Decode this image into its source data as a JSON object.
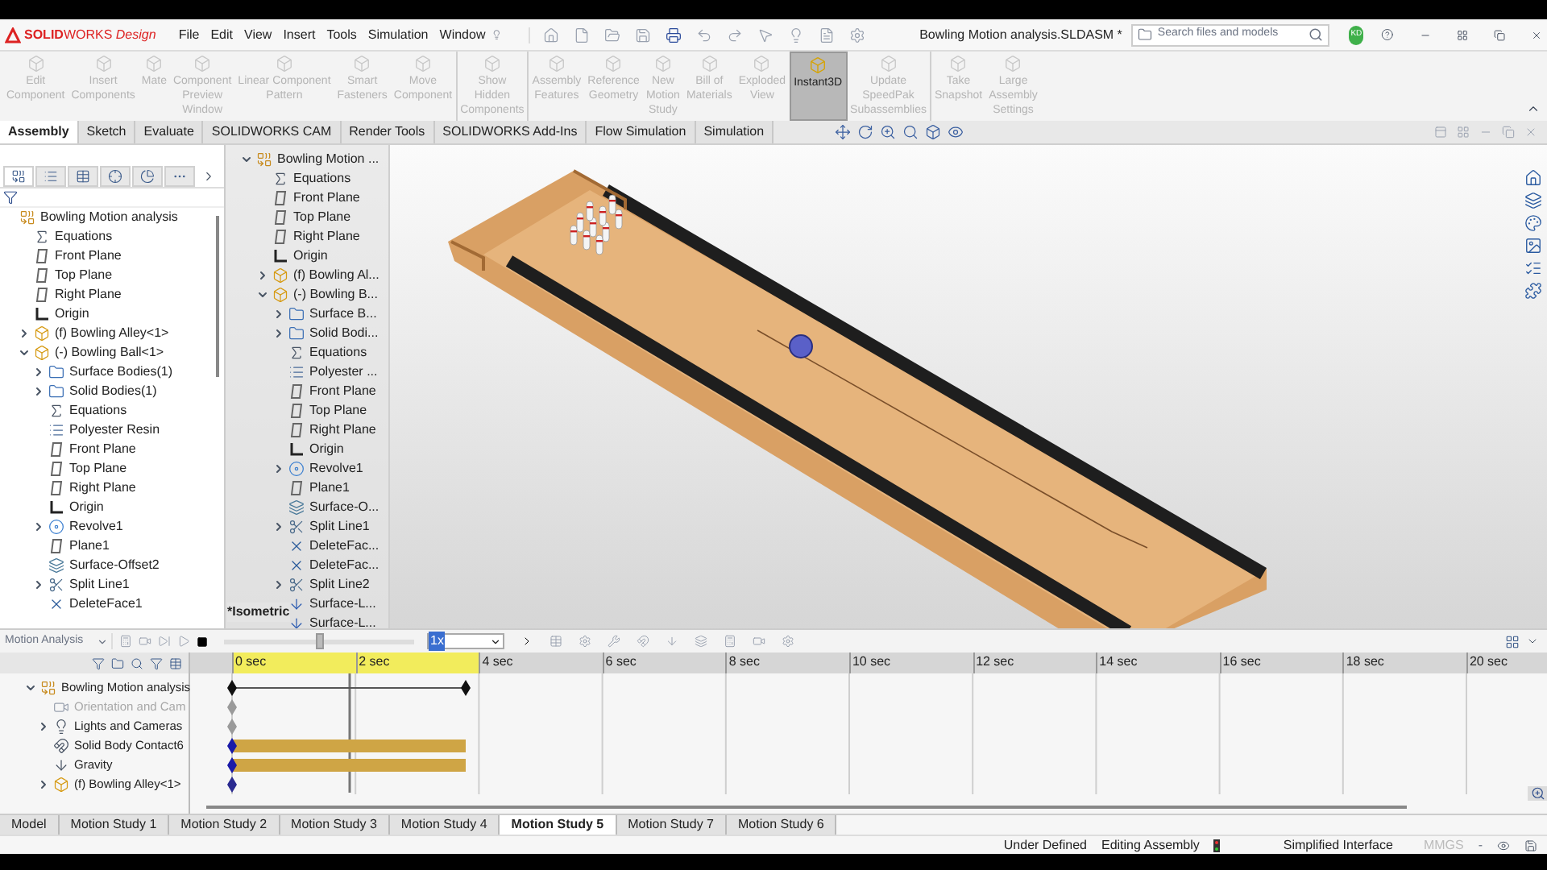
{
  "app": {
    "logo": "**SOLID**WORKS *Design*",
    "menus": [
      "File",
      "Edit",
      "View",
      "Insert",
      "Tools",
      "Simulation",
      "Window"
    ],
    "document_title": "Bowling Motion analysis.SLDASM *",
    "search": {
      "placeholder": "Search files and models"
    },
    "user_initials": "KD"
  },
  "ribbon": [
    {
      "lines": [
        "Edit",
        "Component"
      ],
      "disabled": true,
      "selected": false,
      "group_end": false
    },
    {
      "lines": [
        "Insert",
        "Components"
      ],
      "disabled": true,
      "selected": false,
      "group_end": false
    },
    {
      "lines": [
        "Mate"
      ],
      "disabled": true,
      "selected": false,
      "group_end": false
    },
    {
      "lines": [
        "Component",
        "Preview",
        "Window"
      ],
      "disabled": true,
      "selected": false,
      "group_end": false
    },
    {
      "lines": [
        "Linear Component",
        "Pattern"
      ],
      "disabled": true,
      "selected": false,
      "group_end": false
    },
    {
      "lines": [
        "Smart",
        "Fasteners"
      ],
      "disabled": true,
      "selected": false,
      "group_end": false
    },
    {
      "lines": [
        "Move",
        "Component"
      ],
      "disabled": true,
      "selected": false,
      "group_end": true
    },
    {
      "lines": [
        "Show",
        "Hidden",
        "Components"
      ],
      "disabled": true,
      "selected": false,
      "group_end": true
    },
    {
      "lines": [
        "Assembly",
        "Features"
      ],
      "disabled": true,
      "selected": false,
      "group_end": false
    },
    {
      "lines": [
        "Reference",
        "Geometry"
      ],
      "disabled": true,
      "selected": false,
      "group_end": false
    },
    {
      "lines": [
        "New",
        "Motion",
        "Study"
      ],
      "disabled": true,
      "selected": false,
      "group_end": false
    },
    {
      "lines": [
        "Bill of",
        "Materials"
      ],
      "disabled": true,
      "selected": false,
      "group_end": false
    },
    {
      "lines": [
        "Exploded",
        "View"
      ],
      "disabled": true,
      "selected": false,
      "group_end": false
    },
    {
      "lines": [
        "Instant3D"
      ],
      "disabled": false,
      "selected": true,
      "group_end": false
    },
    {
      "lines": [
        "Update",
        "SpeedPak",
        "Subassemblies"
      ],
      "disabled": true,
      "selected": false,
      "group_end": true
    },
    {
      "lines": [
        "Take",
        "Snapshot"
      ],
      "disabled": true,
      "selected": false,
      "group_end": false
    },
    {
      "lines": [
        "Large",
        "Assembly",
        "Settings"
      ],
      "disabled": true,
      "selected": false,
      "group_end": false
    }
  ],
  "command_tabs": [
    {
      "label": "Assembly",
      "selected": true
    },
    {
      "label": "Sketch",
      "selected": false
    },
    {
      "label": "Evaluate",
      "selected": false
    },
    {
      "label": "SOLIDWORKS CAM",
      "selected": false
    },
    {
      "label": "Render Tools",
      "selected": false
    },
    {
      "label": "SOLIDWORKS Add-Ins",
      "selected": false
    },
    {
      "label": "Flow Simulation",
      "selected": false
    },
    {
      "label": "Simulation",
      "selected": false
    }
  ],
  "panel_tabs": [
    {
      "selected": true
    },
    {
      "selected": false
    },
    {
      "selected": false
    },
    {
      "selected": false
    },
    {
      "selected": false
    },
    {
      "selected": false
    }
  ],
  "feature_tree": {
    "items": [
      {
        "label": "Bowling Motion analysis",
        "kind": "assembly",
        "children": [
          {
            "label": "Equations",
            "kind": "equations"
          },
          {
            "label": "Front Plane",
            "kind": "plane"
          },
          {
            "label": "Top Plane",
            "kind": "plane"
          },
          {
            "label": "Right Plane",
            "kind": "plane"
          },
          {
            "label": "Origin",
            "kind": "origin"
          },
          {
            "label": "(f) Bowling Alley<1>",
            "kind": "part",
            "expanded": false
          },
          {
            "label": "(-) Bowling Ball<1>",
            "kind": "part",
            "expanded": true,
            "children": [
              {
                "label": "Surface Bodies(1)",
                "kind": "bodies",
                "expanded": false
              },
              {
                "label": "Solid Bodies(1)",
                "kind": "bodies",
                "expanded": false
              },
              {
                "label": "Equations",
                "kind": "equations"
              },
              {
                "label": "Polyester Resin",
                "kind": "material"
              },
              {
                "label": "Front Plane",
                "kind": "plane"
              },
              {
                "label": "Top Plane",
                "kind": "plane"
              },
              {
                "label": "Right Plane",
                "kind": "plane"
              },
              {
                "label": "Origin",
                "kind": "origin"
              },
              {
                "label": "Revolve1",
                "kind": "revolve",
                "expanded": false
              },
              {
                "label": "Plane1",
                "kind": "plane"
              },
              {
                "label": "Surface-Offset2",
                "kind": "offset"
              },
              {
                "label": "Split Line1",
                "kind": "split",
                "expanded": false
              },
              {
                "label": "DeleteFace1",
                "kind": "delete"
              }
            ]
          }
        ]
      }
    ]
  },
  "flyout_tree": {
    "items": [
      {
        "label": "Bowling Motion ...",
        "kind": "assembly",
        "expanded": true,
        "children": [
          {
            "label": "Equations",
            "kind": "equations"
          },
          {
            "label": "Front Plane",
            "kind": "plane"
          },
          {
            "label": "Top Plane",
            "kind": "plane"
          },
          {
            "label": "Right Plane",
            "kind": "plane"
          },
          {
            "label": "Origin",
            "kind": "origin"
          },
          {
            "label": "(f) Bowling Al...",
            "kind": "part",
            "expanded": false
          },
          {
            "label": "(-) Bowling B...",
            "kind": "part",
            "expanded": true,
            "children": [
              {
                "label": "Surface B...",
                "kind": "bodies",
                "expanded": false
              },
              {
                "label": "Solid Bodi...",
                "kind": "bodies",
                "expanded": false
              },
              {
                "label": "Equations",
                "kind": "equations"
              },
              {
                "label": "Polyester ...",
                "kind": "material"
              },
              {
                "label": "Front Plane",
                "kind": "plane"
              },
              {
                "label": "Top Plane",
                "kind": "plane"
              },
              {
                "label": "Right Plane",
                "kind": "plane"
              },
              {
                "label": "Origin",
                "kind": "origin"
              },
              {
                "label": "Revolve1",
                "kind": "revolve",
                "expanded": false
              },
              {
                "label": "Plane1",
                "kind": "plane"
              },
              {
                "label": "Surface-O...",
                "kind": "offset"
              },
              {
                "label": "Split Line1",
                "kind": "split",
                "expanded": false
              },
              {
                "label": "DeleteFac...",
                "kind": "delete"
              },
              {
                "label": "DeleteFac...",
                "kind": "delete"
              },
              {
                "label": "Split Line2",
                "kind": "split",
                "expanded": false
              },
              {
                "label": "Surface-L...",
                "kind": "surface"
              },
              {
                "label": "Surface-L...",
                "kind": "surface"
              }
            ]
          }
        ]
      }
    ]
  },
  "viewport": {
    "view_label": "*Isometric"
  },
  "motion": {
    "study_type": "Motion Analysis",
    "speed": "1x",
    "playback": {
      "level": 0.5
    },
    "time_labels": [
      "0 sec",
      "2 sec",
      "4 sec",
      "6 sec",
      "8 sec",
      "10 sec",
      "12 sec",
      "14 sec",
      "16 sec",
      "18 sec",
      "20 sec"
    ],
    "rows": [
      {
        "label": "Bowling Motion analysis",
        "kind": "study",
        "expanded": true,
        "disabled": false,
        "track": {
          "kind": "span"
        },
        "color": "#111111"
      },
      {
        "label": "Orientation and Cam",
        "kind": "orientation",
        "disabled": true,
        "track": {
          "kind": "key"
        },
        "color": "#9a9a9a"
      },
      {
        "label": "Lights and Cameras",
        "kind": "lights",
        "expanded": false,
        "disabled": false,
        "track": {
          "kind": "key"
        },
        "color": "#9a9a9a"
      },
      {
        "label": "Solid Body Contact6",
        "kind": "contact",
        "disabled": false,
        "track": {
          "kind": "bar"
        },
        "color": "#1a1aa8"
      },
      {
        "label": "Gravity",
        "kind": "gravity",
        "disabled": false,
        "track": {
          "kind": "bar"
        },
        "color": "#1a1aa8"
      },
      {
        "label": "(f) Bowling Alley<1>",
        "kind": "part",
        "expanded": false,
        "disabled": false,
        "track": {
          "kind": "key"
        },
        "color": "#2a2a90"
      }
    ]
  },
  "study_tabs": [
    {
      "label": "Model",
      "selected": false
    },
    {
      "label": "Motion Study 1",
      "selected": false
    },
    {
      "label": "Motion Study 2",
      "selected": false
    },
    {
      "label": "Motion Study 3",
      "selected": false
    },
    {
      "label": "Motion Study 4",
      "selected": false
    },
    {
      "label": "Motion Study 5",
      "selected": true
    },
    {
      "label": "Motion Study 7",
      "selected": false
    },
    {
      "label": "Motion Study 6",
      "selected": false
    }
  ],
  "status_bar": {
    "state": "Under Defined",
    "mode": "Editing Assembly",
    "interface": "Simplified Interface",
    "units": "MMGS",
    "separator": "-"
  }
}
